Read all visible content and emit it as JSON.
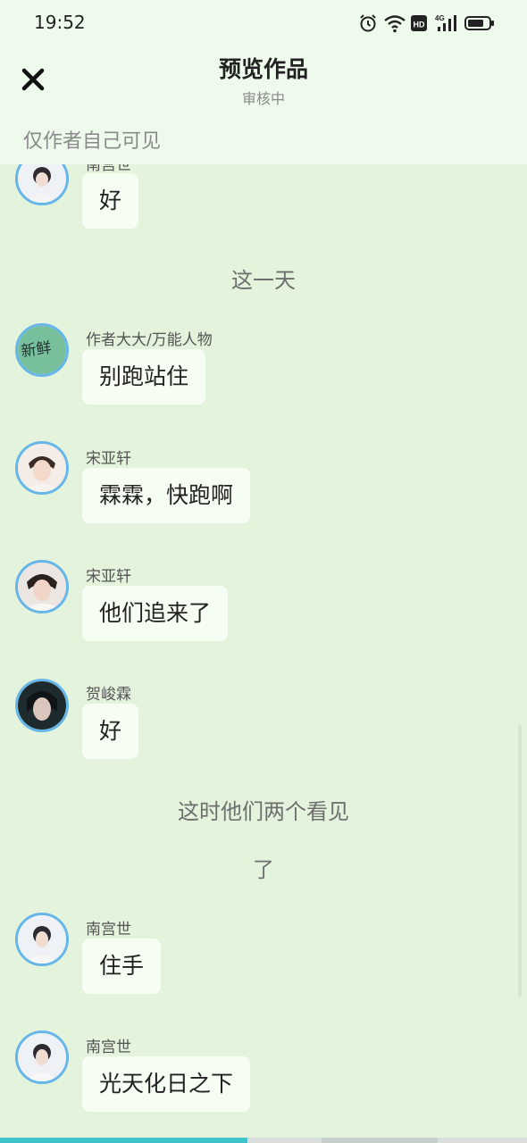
{
  "status_bar": {
    "time": "19:52",
    "icons": [
      "alarm-icon",
      "wifi-icon",
      "hd-icon",
      "signal-4g-icon",
      "battery-icon"
    ],
    "signal_label": "4G"
  },
  "header": {
    "title": "预览作品",
    "subtitle": "审核中",
    "close_icon": "close-icon",
    "visibility_note": "仅作者自己可见"
  },
  "messages": [
    {
      "name": "南宫世",
      "text": "好"
    },
    {
      "narration": "这一天"
    },
    {
      "name": "作者大大/万能人物",
      "text": "别跑站住",
      "avatar_text": "新鲜"
    },
    {
      "name": "宋亚轩",
      "text": "霖霖，快跑啊"
    },
    {
      "name": "宋亚轩",
      "text": "他们追来了"
    },
    {
      "name": "贺峻霖",
      "text": "好"
    },
    {
      "narration": "这时他们两个看见"
    },
    {
      "narration": "了"
    },
    {
      "name": "南宫世",
      "text": "住手"
    },
    {
      "name": "南宫世",
      "text": "光天化日之下"
    }
  ],
  "progress": {
    "fraction": 0.47
  },
  "colors": {
    "background": "#e3f3dc",
    "header": "#eefbec",
    "avatar_ring": "#67b6ea",
    "bubble": "#f6fdf3",
    "progress": "#3fc5c9"
  }
}
